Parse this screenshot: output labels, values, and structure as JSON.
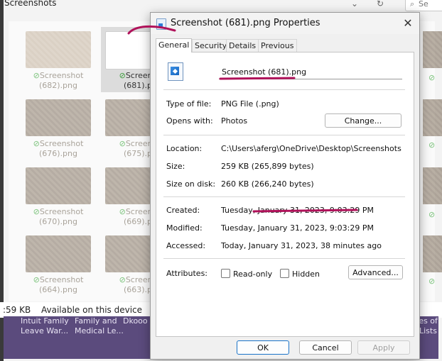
{
  "explorer": {
    "breadcrumb": "Screenshots",
    "search_placeholder": "Se",
    "status_size": ":59 KB",
    "status_availability": "Available on this device",
    "files": [
      {
        "name_1": "Screenshot",
        "name_2": "(682).png"
      },
      {
        "name_1": "Screens",
        "name_2": "(681).p"
      },
      {
        "name_1": "Screenshot",
        "name_2": "(676).png"
      },
      {
        "name_1": "Screens",
        "name_2": "(675).p"
      },
      {
        "name_1": "Screenshot",
        "name_2": "(670).png"
      },
      {
        "name_1": "Screens",
        "name_2": "(669).p"
      },
      {
        "name_1": "Screenshot",
        "name_2": "(664).png"
      },
      {
        "name_1": "Screens",
        "name_2": "(663).p"
      }
    ],
    "desktop_labels": [
      "Intuit Family",
      "Family and",
      "Dkooo",
      "Leave War...",
      "Medical Le...",
      "tes of",
      "Lists"
    ]
  },
  "dialog": {
    "title": "Screenshot (681).png Properties",
    "tabs": [
      "General",
      "Security",
      "Details",
      "Previous Versions"
    ],
    "file_name": "Screenshot (681).png",
    "type_label": "Type of file:",
    "type_value": "PNG File (.png)",
    "opens_label": "Opens with:",
    "opens_value": "Photos",
    "change_button": "Change...",
    "location_label": "Location:",
    "location_value": "C:\\Users\\aferg\\OneDrive\\Desktop\\Screenshots",
    "size_label": "Size:",
    "size_value": "259 KB (265,899 bytes)",
    "size_disk_label": "Size on disk:",
    "size_disk_value": "260 KB (266,240 bytes)",
    "created_label": "Created:",
    "created_value": "Tuesday, January 31, 2023, 9:03:29 PM",
    "modified_label": "Modified:",
    "modified_value": "Tuesday, January 31, 2023, 9:03:29 PM",
    "accessed_label": "Accessed:",
    "accessed_value": "Today, January 31, 2023, 38 minutes ago",
    "attributes_label": "Attributes:",
    "readonly_label": "Read-only",
    "hidden_label": "Hidden",
    "advanced_button": "Advanced...",
    "ok_button": "OK",
    "cancel_button": "Cancel",
    "apply_button": "Apply",
    "close_glyph": "✕"
  },
  "colors": {
    "annotation_ink": "#b0125a",
    "check_green": "#7cc37c",
    "desktop_bg": "#5b4b7d"
  }
}
